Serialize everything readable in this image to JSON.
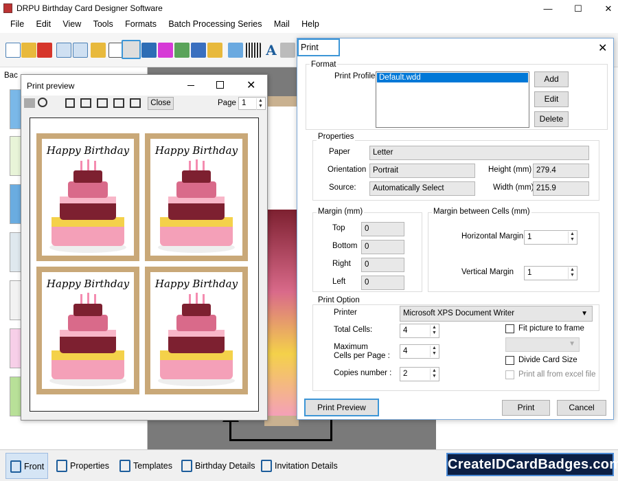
{
  "app": {
    "title": "DRPU Birthday Card Designer Software",
    "controls": {
      "minimize": "—",
      "maximize": "☐",
      "close": "✕"
    }
  },
  "menu": [
    "File",
    "Edit",
    "View",
    "Tools",
    "Formats",
    "Batch Processing Series",
    "Mail",
    "Help"
  ],
  "left_panel": {
    "label": "Bac"
  },
  "print_preview": {
    "title": "Print preview",
    "close_label": "Close",
    "page_label": "Page",
    "page_value": "1",
    "card_text": "Happy Birthday"
  },
  "print_dialog": {
    "title": "Print",
    "format": {
      "legend": "Format",
      "profile_label": "Print Profile",
      "profile_selected": "Default.wdd",
      "add": "Add",
      "edit": "Edit",
      "delete": "Delete"
    },
    "properties": {
      "legend": "Properties",
      "paper_label": "Paper",
      "paper": "Letter",
      "orientation_label": "Orientation",
      "orientation": "Portrait",
      "source_label": "Source:",
      "source": "Automatically Select",
      "height_label": "Height (mm)",
      "height": "279.4",
      "width_label": "Width (mm)",
      "width": "215.9"
    },
    "margin": {
      "legend": "Margin (mm)",
      "top_label": "Top",
      "top": "0",
      "bottom_label": "Bottom",
      "bottom": "0",
      "right_label": "Right",
      "right": "0",
      "left_label": "Left",
      "left": "0"
    },
    "cell_margin": {
      "legend": "Margin between Cells (mm)",
      "horizontal_label": "Horizontal Margin",
      "horizontal": "1",
      "vertical_label": "Vertical Margin",
      "vertical": "1"
    },
    "print_option": {
      "legend": "Print Option",
      "printer_label": "Printer",
      "printer": "Microsoft XPS Document Writer",
      "total_cells_label": "Total Cells:",
      "total_cells": "4",
      "max_cells_label_1": "Maximum",
      "max_cells_label_2": "Cells per Page :",
      "max_cells": "4",
      "copies_label": "Copies number :",
      "copies": "2",
      "fit_picture": "Fit picture to frame",
      "divide_card": "Divide Card Size",
      "print_all": "Print all from excel file"
    },
    "print_preview_btn": "Print Preview",
    "print_btn": "Print",
    "cancel_btn": "Cancel"
  },
  "bottom_tabs": [
    "Front",
    "Properties",
    "Templates",
    "Birthday Details",
    "Invitation Details"
  ],
  "logo": "CreateIDCardBadges.com"
}
